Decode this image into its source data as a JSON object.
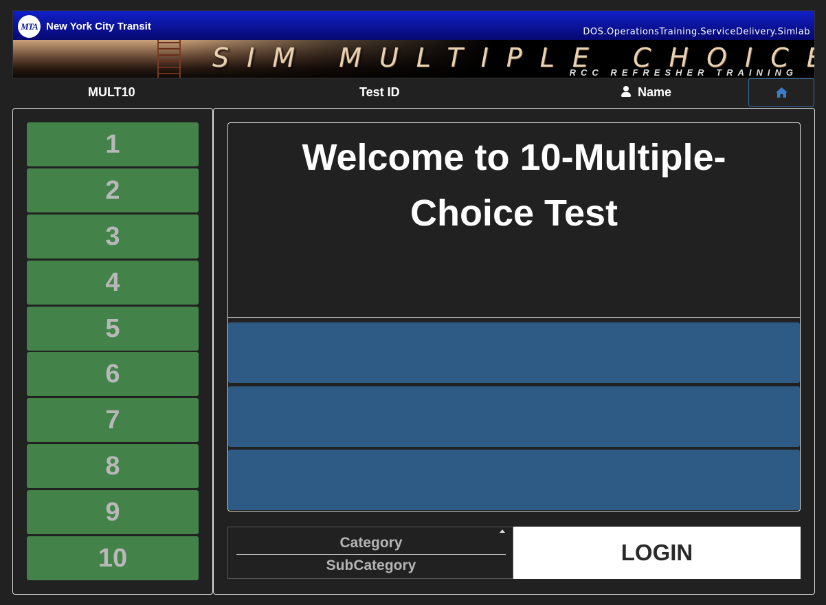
{
  "banner": {
    "logo_text": "MTA",
    "org_name": "New York City Transit",
    "system_path": "DOS.OperationsTraining.ServiceDelivery.Simlab",
    "title": "SIM MULTIPLE CHOICE",
    "subtitle": "RCC REFRESHER TRAINING"
  },
  "infobar": {
    "test_code": "MULT10",
    "test_id_label": "Test ID",
    "user_name": "Name",
    "home_icon": "home-icon"
  },
  "questions": [
    "1",
    "2",
    "3",
    "4",
    "5",
    "6",
    "7",
    "8",
    "9",
    "10"
  ],
  "main": {
    "welcome": "Welcome to 10-Multiple-Choice Test",
    "answers": [
      "",
      "",
      ""
    ],
    "category": "Category",
    "subcategory": "SubCategory",
    "login_label": "LOGIN"
  },
  "colors": {
    "background": "#212121",
    "question_button": "#43834a",
    "answer_button": "#2d5b85",
    "banner_blue": "#0a0f8a"
  }
}
